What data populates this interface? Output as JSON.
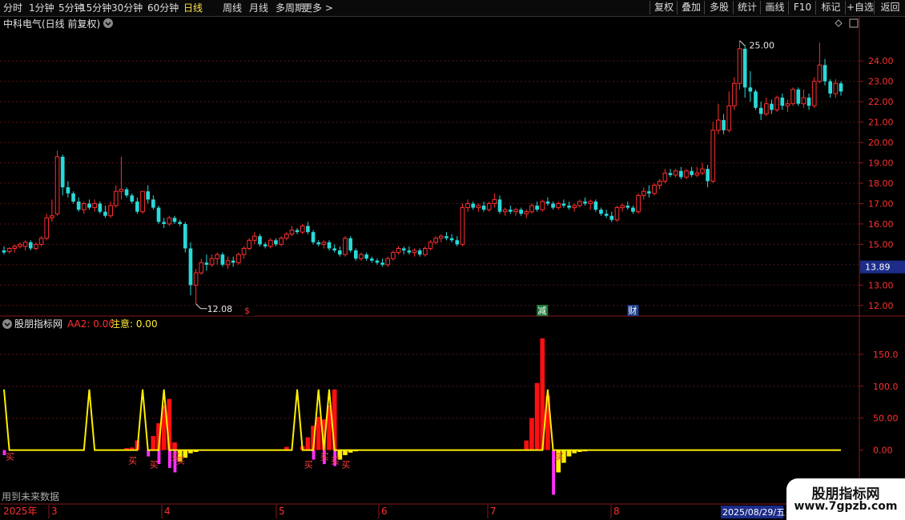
{
  "toolbar": {
    "periods": [
      "分时",
      "1分钟",
      "5分钟",
      "15分钟",
      "30分钟",
      "60分钟",
      "日线",
      "周线",
      "月线",
      "多周期",
      "更多 >"
    ],
    "active_period": "日线",
    "right_buttons": [
      "复权",
      "叠加",
      "多股",
      "统计",
      "画线",
      "F10",
      "标记",
      "+自选",
      "返回"
    ]
  },
  "main_panel": {
    "title": "中科电气(日线 前复权)",
    "price_ticks": [
      "24.00",
      "23.00",
      "22.00",
      "21.00",
      "20.00",
      "19.00",
      "18.00",
      "17.00",
      "16.00",
      "15.00",
      "13.00",
      "12.00"
    ],
    "current_price_tag": "13.89",
    "high_label": "25.00",
    "low_label": "12.08",
    "markers": [
      {
        "text": "$",
        "color": "#ff3030",
        "bg": "#000"
      },
      {
        "text": "减",
        "color": "#ffffff",
        "bg": "#1f7a3a"
      },
      {
        "text": "财",
        "color": "#ffffff",
        "bg": "#1f3f8a"
      }
    ]
  },
  "indicator_panel": {
    "title": "股朋指标网",
    "aa2_label": "AA2: 0.00",
    "notice_label": "注意: 0.00",
    "y_ticks": [
      "150.0",
      "100.0",
      "50.00",
      "0.00"
    ],
    "footer_note": "用到未来数据",
    "buy_label": "买"
  },
  "time_axis": {
    "year_label": "2025年",
    "month_labels": [
      "3",
      "4",
      "5",
      "6",
      "7",
      "8"
    ],
    "date_tag": "2025/08/29/五"
  },
  "watermark": {
    "title": "股朋指标网",
    "url": "www.7gpzb.com"
  },
  "chart_data": [
    {
      "type": "candlestick",
      "title": "中科电气(日线 前复权)",
      "ylim": [
        11.6,
        25.5
      ],
      "up_color": "#ff3030",
      "down_color": "#29d9d9",
      "ohlc": [
        [
          14.7,
          14.9,
          14.5,
          14.6
        ],
        [
          14.65,
          14.85,
          14.55,
          14.8
        ],
        [
          14.8,
          15.0,
          14.6,
          14.9
        ],
        [
          14.9,
          15.1,
          14.8,
          15.0
        ],
        [
          14.9,
          15.2,
          14.7,
          15.1
        ],
        [
          15.1,
          15.2,
          14.7,
          14.8
        ],
        [
          14.8,
          15.1,
          14.7,
          15.0
        ],
        [
          15.0,
          15.4,
          14.9,
          15.3
        ],
        [
          15.3,
          16.5,
          15.2,
          16.3
        ],
        [
          16.3,
          17.2,
          16.1,
          16.4
        ],
        [
          16.5,
          19.6,
          16.4,
          19.3
        ],
        [
          19.3,
          19.4,
          17.4,
          17.8
        ],
        [
          17.8,
          18.1,
          17.3,
          17.5
        ],
        [
          17.5,
          17.6,
          17.0,
          17.1
        ],
        [
          17.1,
          17.3,
          16.6,
          16.7
        ],
        [
          16.7,
          17.1,
          16.5,
          17.0
        ],
        [
          17.0,
          17.2,
          16.7,
          16.8
        ],
        [
          16.8,
          17.2,
          16.6,
          17.0
        ],
        [
          17.0,
          17.1,
          16.5,
          16.6
        ],
        [
          16.6,
          16.9,
          16.3,
          16.4
        ],
        [
          16.4,
          17.1,
          16.3,
          16.9
        ],
        [
          16.9,
          17.9,
          16.8,
          17.6
        ],
        [
          17.6,
          19.3,
          17.2,
          17.7
        ],
        [
          17.7,
          17.8,
          17.3,
          17.4
        ],
        [
          17.4,
          17.5,
          17.0,
          17.1
        ],
        [
          17.1,
          17.3,
          16.5,
          16.6
        ],
        [
          16.6,
          17.6,
          16.5,
          17.6
        ],
        [
          17.6,
          17.9,
          17.0,
          17.2
        ],
        [
          17.2,
          17.4,
          16.7,
          16.8
        ],
        [
          16.8,
          16.9,
          16.0,
          16.1
        ],
        [
          16.1,
          16.3,
          15.8,
          16.0
        ],
        [
          16.0,
          16.4,
          15.9,
          16.3
        ],
        [
          16.3,
          16.4,
          16.0,
          16.1
        ],
        [
          16.1,
          16.2,
          15.9,
          16.0
        ],
        [
          16.0,
          16.1,
          14.6,
          14.8
        ],
        [
          14.8,
          15.1,
          12.5,
          13.0
        ],
        [
          13.0,
          13.8,
          12.08,
          13.6
        ],
        [
          13.6,
          14.3,
          13.5,
          14.1
        ],
        [
          14.1,
          14.5,
          13.7,
          14.0
        ],
        [
          14.0,
          14.5,
          13.9,
          14.3
        ],
        [
          14.3,
          14.6,
          14.0,
          14.5
        ],
        [
          14.5,
          14.6,
          13.9,
          14.0
        ],
        [
          14.0,
          14.4,
          13.8,
          14.2
        ],
        [
          14.2,
          14.4,
          13.9,
          14.1
        ],
        [
          14.1,
          14.6,
          14.0,
          14.5
        ],
        [
          14.5,
          14.9,
          14.3,
          14.8
        ],
        [
          14.8,
          15.3,
          14.7,
          15.2
        ],
        [
          15.2,
          15.6,
          15.0,
          15.4
        ],
        [
          15.4,
          15.5,
          14.9,
          15.0
        ],
        [
          15.0,
          15.1,
          14.8,
          14.9
        ],
        [
          14.9,
          15.3,
          14.8,
          15.2
        ],
        [
          15.2,
          15.3,
          14.9,
          15.0
        ],
        [
          15.0,
          15.4,
          14.9,
          15.3
        ],
        [
          15.3,
          15.6,
          15.2,
          15.5
        ],
        [
          15.5,
          15.9,
          15.4,
          15.7
        ],
        [
          15.7,
          15.8,
          15.5,
          15.6
        ],
        [
          15.6,
          16.0,
          15.5,
          15.9
        ],
        [
          15.9,
          16.1,
          15.5,
          15.6
        ],
        [
          15.6,
          15.7,
          15.0,
          15.1
        ],
        [
          15.1,
          15.2,
          14.9,
          15.0
        ],
        [
          15.0,
          15.2,
          14.8,
          15.1
        ],
        [
          15.1,
          15.2,
          14.7,
          14.8
        ],
        [
          14.8,
          15.0,
          14.6,
          14.7
        ],
        [
          14.7,
          14.9,
          14.4,
          14.5
        ],
        [
          14.5,
          15.4,
          14.4,
          15.3
        ],
        [
          15.3,
          15.4,
          14.6,
          14.7
        ],
        [
          14.7,
          14.8,
          14.2,
          14.3
        ],
        [
          14.3,
          14.6,
          14.2,
          14.5
        ],
        [
          14.5,
          14.6,
          14.2,
          14.3
        ],
        [
          14.3,
          14.4,
          14.1,
          14.2
        ],
        [
          14.2,
          14.3,
          14.0,
          14.1
        ],
        [
          14.1,
          14.3,
          13.9,
          14.0
        ],
        [
          14.0,
          14.4,
          13.9,
          14.3
        ],
        [
          14.3,
          14.7,
          14.2,
          14.6
        ],
        [
          14.6,
          14.9,
          14.5,
          14.8
        ],
        [
          14.8,
          14.9,
          14.5,
          14.7
        ],
        [
          14.7,
          14.9,
          14.5,
          14.6
        ],
        [
          14.6,
          14.8,
          14.4,
          14.7
        ],
        [
          14.7,
          14.8,
          14.4,
          14.5
        ],
        [
          14.5,
          14.9,
          14.4,
          14.8
        ],
        [
          14.8,
          15.2,
          14.7,
          15.1
        ],
        [
          15.1,
          15.4,
          15.0,
          15.3
        ],
        [
          15.3,
          15.5,
          15.1,
          15.4
        ],
        [
          15.4,
          15.6,
          15.2,
          15.3
        ],
        [
          15.3,
          15.5,
          15.1,
          15.2
        ],
        [
          15.2,
          15.4,
          14.9,
          15.0
        ],
        [
          15.0,
          17.0,
          14.9,
          16.8
        ],
        [
          16.8,
          17.2,
          16.6,
          17.0
        ],
        [
          17.0,
          17.1,
          16.7,
          16.8
        ],
        [
          16.8,
          17.0,
          16.6,
          16.9
        ],
        [
          16.9,
          17.1,
          16.6,
          16.7
        ],
        [
          16.7,
          17.1,
          16.6,
          17.0
        ],
        [
          17.0,
          17.5,
          16.8,
          17.2
        ],
        [
          17.2,
          17.4,
          16.5,
          16.6
        ],
        [
          16.6,
          16.8,
          16.4,
          16.7
        ],
        [
          16.7,
          16.9,
          16.5,
          16.6
        ],
        [
          16.6,
          16.8,
          16.4,
          16.7
        ],
        [
          16.7,
          16.8,
          16.4,
          16.5
        ],
        [
          16.5,
          16.7,
          16.3,
          16.6
        ],
        [
          16.6,
          17.0,
          16.5,
          16.9
        ],
        [
          16.9,
          17.1,
          16.6,
          16.7
        ],
        [
          16.7,
          17.2,
          16.6,
          17.1
        ],
        [
          17.1,
          17.3,
          16.9,
          17.0
        ],
        [
          17.0,
          17.1,
          16.7,
          16.8
        ],
        [
          16.8,
          17.1,
          16.7,
          17.0
        ],
        [
          17.0,
          17.2,
          16.8,
          16.9
        ],
        [
          16.9,
          17.1,
          16.7,
          16.8
        ],
        [
          16.8,
          17.0,
          16.6,
          16.9
        ],
        [
          16.9,
          17.2,
          16.8,
          17.1
        ],
        [
          17.1,
          17.3,
          16.9,
          17.0
        ],
        [
          17.0,
          17.2,
          16.7,
          17.1
        ],
        [
          17.1,
          17.2,
          16.6,
          16.7
        ],
        [
          16.7,
          16.8,
          16.4,
          16.5
        ],
        [
          16.5,
          16.7,
          16.3,
          16.4
        ],
        [
          16.4,
          16.6,
          16.1,
          16.2
        ],
        [
          16.2,
          16.9,
          16.1,
          16.8
        ],
        [
          16.8,
          17.0,
          16.6,
          16.9
        ],
        [
          16.9,
          17.1,
          16.7,
          16.8
        ],
        [
          16.8,
          16.9,
          16.5,
          16.6
        ],
        [
          16.6,
          17.5,
          16.5,
          17.4
        ],
        [
          17.4,
          17.8,
          17.2,
          17.6
        ],
        [
          17.6,
          17.9,
          17.3,
          17.5
        ],
        [
          17.5,
          18.0,
          17.4,
          17.9
        ],
        [
          17.9,
          18.2,
          17.7,
          18.1
        ],
        [
          18.1,
          18.7,
          18.0,
          18.5
        ],
        [
          18.5,
          18.7,
          18.3,
          18.4
        ],
        [
          18.4,
          18.7,
          18.3,
          18.6
        ],
        [
          18.6,
          18.8,
          18.2,
          18.3
        ],
        [
          18.3,
          18.7,
          18.2,
          18.6
        ],
        [
          18.6,
          18.8,
          18.3,
          18.4
        ],
        [
          18.4,
          18.8,
          18.3,
          18.5
        ],
        [
          18.5,
          19.0,
          18.4,
          18.7
        ],
        [
          18.7,
          18.9,
          17.8,
          18.1
        ],
        [
          18.1,
          21.0,
          18.0,
          20.6
        ],
        [
          20.6,
          21.9,
          20.4,
          21.1
        ],
        [
          21.1,
          21.4,
          20.4,
          20.6
        ],
        [
          20.6,
          22.5,
          20.5,
          21.8
        ],
        [
          21.8,
          23.2,
          21.6,
          22.9
        ],
        [
          22.9,
          25.0,
          22.6,
          24.6
        ],
        [
          24.6,
          24.8,
          22.2,
          22.7
        ],
        [
          22.7,
          23.5,
          22.0,
          22.5
        ],
        [
          22.5,
          22.6,
          21.6,
          21.7
        ],
        [
          21.7,
          22.0,
          21.1,
          21.4
        ],
        [
          21.4,
          22.2,
          21.3,
          21.9
        ],
        [
          21.9,
          22.1,
          21.4,
          21.6
        ],
        [
          21.6,
          22.3,
          21.5,
          22.2
        ],
        [
          22.2,
          22.4,
          21.6,
          21.8
        ],
        [
          21.8,
          22.1,
          21.5,
          21.9
        ],
        [
          21.9,
          22.7,
          21.8,
          22.6
        ],
        [
          22.6,
          22.7,
          21.8,
          21.9
        ],
        [
          21.9,
          22.6,
          21.7,
          22.2
        ],
        [
          22.2,
          22.4,
          21.6,
          21.8
        ],
        [
          21.8,
          23.2,
          21.7,
          23.0
        ],
        [
          23.0,
          24.9,
          22.9,
          23.8
        ],
        [
          23.8,
          24.1,
          22.8,
          23.0
        ],
        [
          23.0,
          23.1,
          22.2,
          22.4
        ],
        [
          22.4,
          23.1,
          22.2,
          22.9
        ],
        [
          22.9,
          23.0,
          22.3,
          22.5
        ]
      ],
      "events": [
        {
          "x_index": 46,
          "label": "$"
        },
        {
          "x_index": 101,
          "label": "减"
        },
        {
          "x_index": 118,
          "label": "财"
        }
      ]
    },
    {
      "type": "bar",
      "title": "股朋指标网",
      "ylim": [
        -72,
        185
      ],
      "yline_series": "AA2 (yellow spike line)",
      "spike_indices": [
        0,
        16,
        26,
        30,
        55,
        59,
        61,
        102
      ],
      "spike_value": 95,
      "red_bars": [
        {
          "i": 23,
          "v": 3
        },
        {
          "i": 24,
          "v": 4
        },
        {
          "i": 25,
          "v": 15
        },
        {
          "i": 28,
          "v": 22
        },
        {
          "i": 29,
          "v": 42
        },
        {
          "i": 30,
          "v": 70
        },
        {
          "i": 31,
          "v": 80
        },
        {
          "i": 32,
          "v": 12
        },
        {
          "i": 53,
          "v": 5
        },
        {
          "i": 56,
          "v": 6
        },
        {
          "i": 57,
          "v": 20
        },
        {
          "i": 58,
          "v": 38
        },
        {
          "i": 59,
          "v": 52
        },
        {
          "i": 60,
          "v": 48
        },
        {
          "i": 61,
          "v": 70
        },
        {
          "i": 62,
          "v": 95
        },
        {
          "i": 98,
          "v": 15
        },
        {
          "i": 99,
          "v": 50
        },
        {
          "i": 100,
          "v": 105
        },
        {
          "i": 101,
          "v": 175
        },
        {
          "i": 102,
          "v": 85
        }
      ],
      "yellow_bars": [
        {
          "i": 33,
          "v": -18
        },
        {
          "i": 34,
          "v": -12
        },
        {
          "i": 35,
          "v": -5
        },
        {
          "i": 36,
          "v": -3
        },
        {
          "i": 63,
          "v": -15
        },
        {
          "i": 64,
          "v": -8
        },
        {
          "i": 65,
          "v": -4
        },
        {
          "i": 66,
          "v": -2
        },
        {
          "i": 104,
          "v": -35
        },
        {
          "i": 105,
          "v": -20
        },
        {
          "i": 106,
          "v": -10
        },
        {
          "i": 107,
          "v": -5
        },
        {
          "i": 108,
          "v": -3
        },
        {
          "i": 109,
          "v": -2
        }
      ],
      "magenta_bars": [
        {
          "i": 0,
          "v": -8
        },
        {
          "i": 27,
          "v": -10
        },
        {
          "i": 29,
          "v": -22
        },
        {
          "i": 31,
          "v": -28
        },
        {
          "i": 32,
          "v": -35
        },
        {
          "i": 58,
          "v": -15
        },
        {
          "i": 60,
          "v": -22
        },
        {
          "i": 62,
          "v": -25
        },
        {
          "i": 103,
          "v": -70
        }
      ],
      "buy_points": [
        0,
        23,
        27,
        31,
        32,
        56,
        59,
        61,
        63,
        103
      ]
    }
  ]
}
